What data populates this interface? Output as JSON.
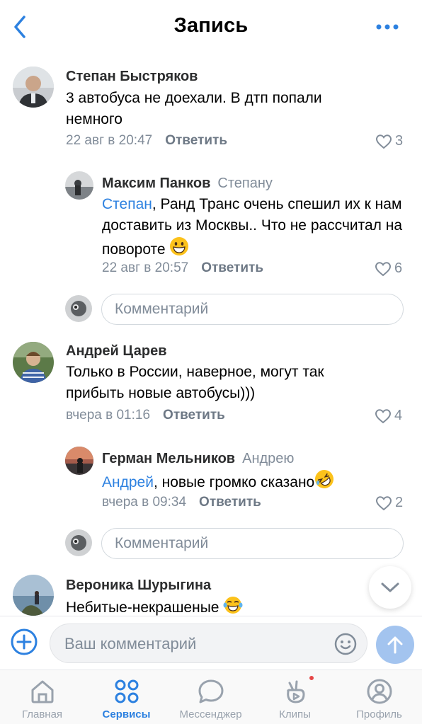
{
  "header": {
    "title": "Запись"
  },
  "colors": {
    "accent": "#2d81e0",
    "secondary_text": "#818c99",
    "send_disabled": "#a3c4ef",
    "badge": "#e64646"
  },
  "comments": [
    {
      "author": "Степан Быстряков",
      "text": "3 автобуса не доехали. В дтп попали немного",
      "time": "22 авг в 20:47",
      "reply_label": "Ответить",
      "likes": "3"
    },
    {
      "author": "Максим Панков",
      "reply_to": "Степану",
      "mention": "Степан",
      "text": ", Ранд Транс очень спешил их к нам доставить из Москвы.. Что не рассчитал на повороте",
      "emoji": "grinning-face-icon",
      "time": "22 авг в 20:57",
      "reply_label": "Ответить",
      "likes": "6"
    },
    {
      "author": "Андрей Царев",
      "text": "Только в России, наверное, могут так прибыть новые автобусы)))",
      "time": "вчера в 01:16",
      "reply_label": "Ответить",
      "likes": "4"
    },
    {
      "author": "Герман Мельников",
      "reply_to": "Андрею",
      "mention": "Андрей",
      "text": ", новые громко сказано",
      "emoji": "rolling-laughing-face-icon",
      "time": "вчера в 09:34",
      "reply_label": "Ответить",
      "likes": "2"
    },
    {
      "author": "Вероника Шурыгина",
      "text": "Небитые-некрашеные",
      "emoji": "tears-of-joy-face-icon"
    }
  ],
  "thread_reply_placeholder": "Комментарий",
  "composer": {
    "placeholder": "Ваш комментарий"
  },
  "tabs": [
    {
      "label": "Главная",
      "icon": "home-icon"
    },
    {
      "label": "Сервисы",
      "icon": "services-grid-icon",
      "active": true
    },
    {
      "label": "Мессенджер",
      "icon": "chat-bubble-icon"
    },
    {
      "label": "Клипы",
      "icon": "clips-icon",
      "badge": true
    },
    {
      "label": "Профиль",
      "icon": "profile-icon"
    }
  ]
}
